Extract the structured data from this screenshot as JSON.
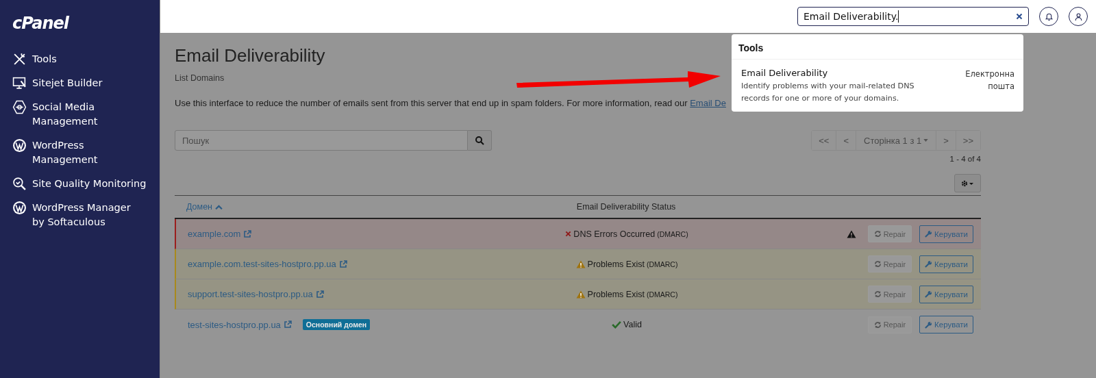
{
  "sidebar": {
    "logo": "cPanel",
    "items": [
      {
        "label": "Tools"
      },
      {
        "label": "Sitejet Builder"
      },
      {
        "label": "Social Media Management"
      },
      {
        "label": "WordPress Management"
      },
      {
        "label": "Site Quality Monitoring"
      },
      {
        "label": "WordPress Manager by Softaculous"
      }
    ]
  },
  "topbar": {
    "search_value": "Email Deliverability."
  },
  "search_dropdown": {
    "heading": "Tools",
    "result": {
      "title": "Email Deliverability",
      "description": "Identify problems with your mail-related DNS records for one or more of your domains.",
      "category": "Електронна пошта"
    }
  },
  "page": {
    "title": "Email Deliverability",
    "subtitle": "List Domains",
    "intro": "Use this interface to reduce the number of emails sent from this server that end up in spam folders. For more information, read our ",
    "intro_link": "Email De"
  },
  "filter": {
    "placeholder": "Пошук"
  },
  "pagination": {
    "first": "<<",
    "prev": "<",
    "page": "Сторінка 1 з 1",
    "next": ">",
    "last": ">>",
    "count": "1 - 4 of 4"
  },
  "table": {
    "columns": [
      "Домен",
      "Email Deliverability Status"
    ],
    "rows": [
      {
        "domain": "example.com",
        "kind": "error",
        "status": "DNS Errors Occurred",
        "status_detail": "(DMARC)",
        "primary_badge": null,
        "alert": true,
        "repair": "Repair",
        "repair_disabled": true,
        "manage": "Керувати"
      },
      {
        "domain": "example.com.test-sites-hostpro.pp.ua",
        "kind": "warning",
        "status": "Problems Exist",
        "status_detail": "(DMARC)",
        "primary_badge": null,
        "alert": false,
        "repair": "Repair",
        "repair_disabled": true,
        "manage": "Керувати"
      },
      {
        "domain": "support.test-sites-hostpro.pp.ua",
        "kind": "warning",
        "status": "Problems Exist",
        "status_detail": "(DMARC)",
        "primary_badge": null,
        "alert": false,
        "repair": "Repair",
        "repair_disabled": true,
        "manage": "Керувати"
      },
      {
        "domain": "test-sites-hostpro.pp.ua",
        "kind": "valid",
        "status": "Valid",
        "status_detail": null,
        "primary_badge": "Основний домен",
        "alert": false,
        "repair": "Repair",
        "repair_disabled": true,
        "manage": "Керувати"
      }
    ]
  }
}
